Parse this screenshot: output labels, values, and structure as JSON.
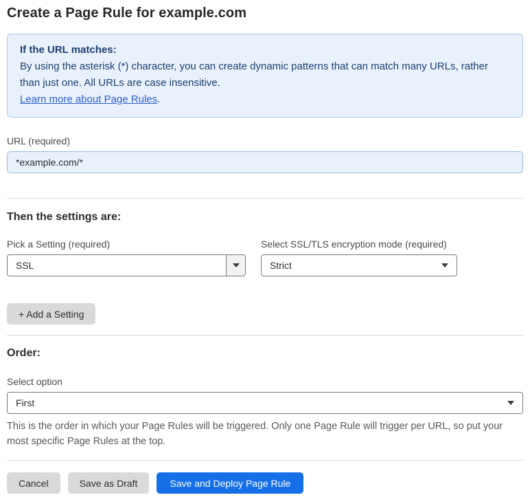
{
  "page": {
    "title": "Create a Page Rule for example.com"
  },
  "info_box": {
    "heading": "If the URL matches:",
    "body": "By using the asterisk (*) character, you can create dynamic patterns that can match many URLs, rather than just one. All URLs are case insensitive.",
    "link_label": "Learn more about Page Rules",
    "link_suffix": "."
  },
  "url_field": {
    "label": "URL (required)",
    "value": "*example.com/*"
  },
  "settings_section": {
    "heading": "Then the settings are:",
    "pick_setting": {
      "label": "Pick a Setting (required)",
      "value": "SSL"
    },
    "ssl_mode": {
      "label": "Select SSL/TLS encryption mode (required)",
      "value": "Strict"
    },
    "add_setting_label": "+ Add a Setting"
  },
  "order_section": {
    "heading": "Order:",
    "select_label": "Select option",
    "value": "First",
    "help_text": "This is the order in which your Page Rules will be triggered. Only one Page Rule will trigger per URL, so put your most specific Page Rules at the top."
  },
  "footer": {
    "cancel_label": "Cancel",
    "save_draft_label": "Save as Draft",
    "save_deploy_label": "Save and Deploy Page Rule"
  },
  "colors": {
    "accent_blue": "#1570e8",
    "info_bg": "#e9f2fc",
    "info_border": "#a9c9e9",
    "info_text": "#1d3d6f",
    "link_blue": "#2a5cc9",
    "input_bg": "#e8f1fc",
    "input_border": "#9db9d8"
  },
  "icons": {
    "dropdown_arrow": "caret-down-icon"
  }
}
